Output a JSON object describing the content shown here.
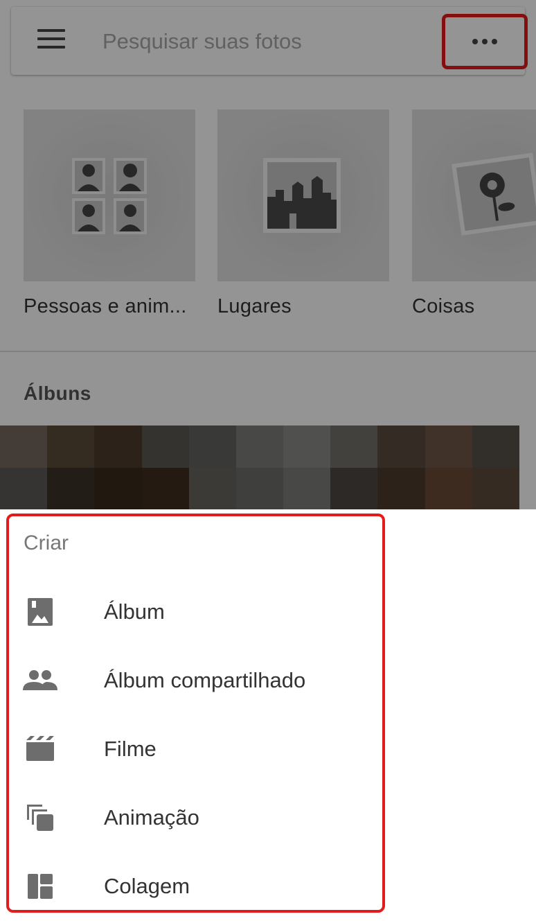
{
  "search": {
    "placeholder": "Pesquisar suas fotos"
  },
  "icons": {
    "menu": "hamburger-icon",
    "more": "more-horizontal-icon"
  },
  "categories": [
    {
      "label": "Pessoas e anim...",
      "icon": "people-grid-icon"
    },
    {
      "label": "Lugares",
      "icon": "city-landscape-icon"
    },
    {
      "label": "Coisas",
      "icon": "flower-photo-icon"
    }
  ],
  "albums": {
    "title": "Álbuns"
  },
  "mosaic_colors": [
    "#766a5f",
    "#5a4a39",
    "#4c3c2c",
    "#5c5953",
    "#626260",
    "#7d7d7b",
    "#8a8a89",
    "#72716c",
    "#5b4b40",
    "#6e5746",
    "#575047",
    "#5d5b58",
    "#3b3226",
    "#3a2b1b",
    "#3e2d1e",
    "#666460",
    "#6d6d6b",
    "#7c7c7b",
    "#4f4842",
    "#4c3b2e",
    "#6a4b37",
    "#5c4a3c"
  ],
  "menu": {
    "title": "Criar",
    "items": [
      {
        "label": "Álbum",
        "icon": "photo-album-icon"
      },
      {
        "label": "Álbum compartilhado",
        "icon": "people-icon"
      },
      {
        "label": "Filme",
        "icon": "movie-clapper-icon"
      },
      {
        "label": "Animação",
        "icon": "stacked-frames-icon"
      },
      {
        "label": "Colagem",
        "icon": "collage-icon"
      }
    ]
  },
  "colors": {
    "highlight": "#e31b1b",
    "icon": "#6d6d6d"
  }
}
